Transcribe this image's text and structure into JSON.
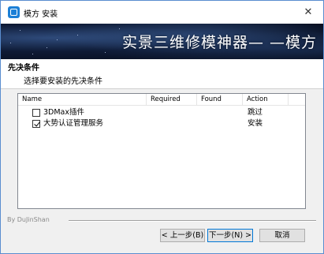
{
  "window": {
    "title": "模方 安装",
    "close_glyph": "✕"
  },
  "banner": {
    "text": "实景三维修模神器— —模方"
  },
  "section": {
    "title": "先决条件",
    "subtitle": "选择要安装的先决条件"
  },
  "listview": {
    "columns": [
      "Name",
      "Required",
      "Found",
      "Action"
    ],
    "rows": [
      {
        "name": "3DMax插件",
        "checked": false,
        "required": "",
        "found": "",
        "action": "跳过"
      },
      {
        "name": "大势认证管理服务",
        "checked": true,
        "required": "",
        "found": "",
        "action": "安装"
      }
    ]
  },
  "footer": {
    "label": "By DuJinShan"
  },
  "buttons": {
    "back": "< 上一步(B)",
    "next": "下一步(N) >",
    "cancel": "取消"
  },
  "colors": {
    "accent": "#0078d7",
    "window_border": "#5a8dcf",
    "banner_dark": "#050a18"
  },
  "icons": {
    "app": "app-logo-icon",
    "close": "close-icon",
    "checkbox": "checkbox-icon"
  }
}
